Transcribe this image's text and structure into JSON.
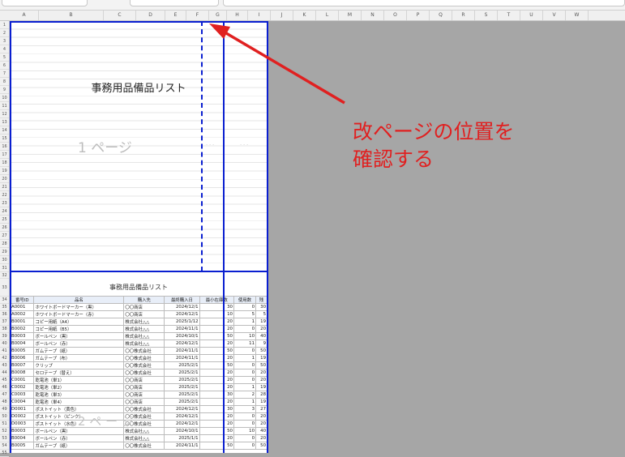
{
  "columns": [
    "A",
    "B",
    "C",
    "D",
    "E",
    "F",
    "G",
    "H",
    "I",
    "J",
    "K",
    "L",
    "M",
    "N",
    "O",
    "P",
    "Q",
    "R",
    "S",
    "T",
    "U",
    "V",
    "W"
  ],
  "rows_page1": [
    "1",
    "2",
    "3",
    "4",
    "5",
    "6",
    "7",
    "8",
    "9",
    "10",
    "11",
    "12",
    "13",
    "14",
    "15",
    "16",
    "17",
    "18",
    "19",
    "20",
    "21",
    "22",
    "23",
    "24",
    "25",
    "26",
    "27",
    "28",
    "29",
    "30",
    "31"
  ],
  "rows_page2": [
    "32",
    "33",
    "34",
    "35",
    "36",
    "37",
    "38",
    "39",
    "40",
    "41",
    "42",
    "43",
    "44",
    "45",
    "46",
    "47",
    "48",
    "49",
    "50",
    "51",
    "52",
    "53",
    "54",
    "55"
  ],
  "page1": {
    "title": "事務用品備品リスト",
    "watermark": "1 ページ"
  },
  "page2": {
    "title": "事務用品備品リスト",
    "watermark": "2 ペ ー ジ"
  },
  "table": {
    "headers": [
      "番号ID",
      "品名",
      "購入先",
      "最終購入日",
      "最小在庫数",
      "使用数",
      "残"
    ],
    "rows": [
      [
        "A0001",
        "ホワイトボードマーカー（黒）",
        "〇〇商店",
        "2024/12/1",
        "30",
        "0",
        "30"
      ],
      [
        "A0002",
        "ホワイトボードマーカー（赤）",
        "〇〇商店",
        "2024/12/1",
        "10",
        "5",
        "5"
      ],
      [
        "B0001",
        "コピー用紙（A4）",
        "株式会社△△",
        "2025/1/12",
        "20",
        "1",
        "19"
      ],
      [
        "B0002",
        "コピー用紙（B5）",
        "株式会社△△",
        "2024/11/1",
        "20",
        "0",
        "20"
      ],
      [
        "B0003",
        "ボールペン（黒）",
        "株式会社△△",
        "2024/10/1",
        "50",
        "10",
        "40"
      ],
      [
        "B0004",
        "ボールペン（赤）",
        "株式会社△△",
        "2024/12/1",
        "20",
        "11",
        "9"
      ],
      [
        "B0005",
        "ガムテープ（紙）",
        "〇〇株式会社",
        "2024/11/1",
        "50",
        "0",
        "50"
      ],
      [
        "B0006",
        "ガムテープ（布）",
        "〇〇株式会社",
        "2024/11/1",
        "20",
        "1",
        "19"
      ],
      [
        "B0007",
        "クリップ",
        "〇〇株式会社",
        "2025/2/1",
        "50",
        "0",
        "50"
      ],
      [
        "B0008",
        "セロテープ（替え）",
        "〇〇株式会社",
        "2025/2/1",
        "20",
        "0",
        "20"
      ],
      [
        "C0001",
        "乾電池（単1）",
        "〇〇商店",
        "2025/2/1",
        "20",
        "0",
        "20"
      ],
      [
        "C0002",
        "乾電池（単2）",
        "〇〇商店",
        "2025/2/1",
        "20",
        "1",
        "19"
      ],
      [
        "C0003",
        "乾電池（単3）",
        "〇〇商店",
        "2025/2/1",
        "30",
        "2",
        "28"
      ],
      [
        "C0004",
        "乾電池（単4）",
        "〇〇商店",
        "2025/2/1",
        "20",
        "1",
        "19"
      ],
      [
        "D0001",
        "ポストイット（黄色）",
        "〇〇株式会社",
        "2024/12/1",
        "30",
        "3",
        "27"
      ],
      [
        "D0002",
        "ポストイット（ピンク）",
        "〇〇株式会社",
        "2024/12/1",
        "20",
        "0",
        "20"
      ],
      [
        "D0003",
        "ポストイット（水色）",
        "〇〇株式会社",
        "2024/12/1",
        "20",
        "0",
        "20"
      ],
      [
        "B0003",
        "ボールペン（黒）",
        "株式会社△△",
        "2024/10/1",
        "50",
        "10",
        "40"
      ],
      [
        "B0004",
        "ボールペン（赤）",
        "株式会社△△",
        "2025/1/1",
        "20",
        "0",
        "20"
      ],
      [
        "B0005",
        "ガムテープ（紙）",
        "〇〇株式会社",
        "2024/11/1",
        "50",
        "0",
        "50"
      ]
    ]
  },
  "annotation": {
    "line1": "改ページの位置を",
    "line2": "確認する"
  },
  "colors": {
    "page_break": "#0a1fd0",
    "annotation": "#e02020",
    "background": "#a6a6a6"
  }
}
